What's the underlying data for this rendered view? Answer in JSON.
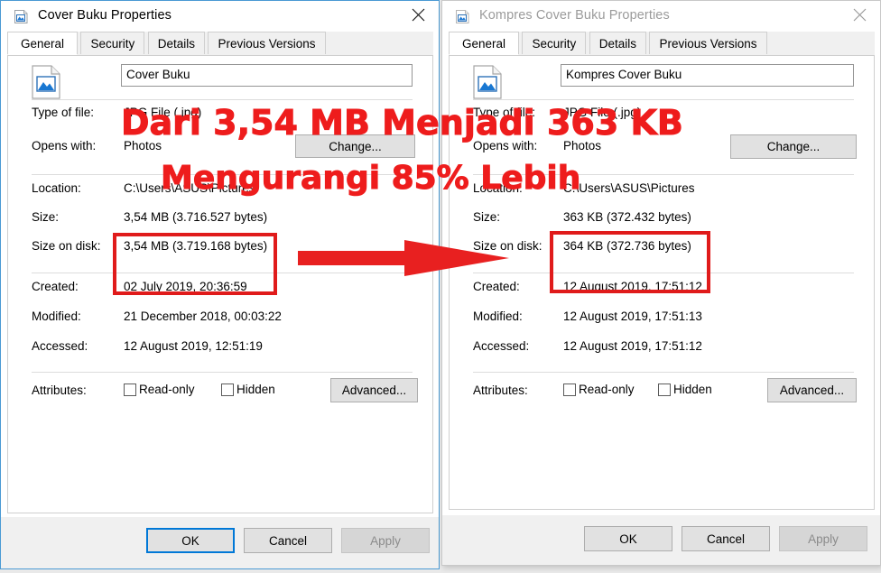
{
  "windows": [
    {
      "id": "left",
      "title": "Cover Buku Properties",
      "title_icon": "image-file-icon",
      "close_icon": "close-icon",
      "tabs": [
        {
          "label": "General",
          "active": true
        },
        {
          "label": "Security",
          "active": false
        },
        {
          "label": "Details",
          "active": false
        },
        {
          "label": "Previous Versions",
          "active": false
        }
      ],
      "file_name": "Cover Buku",
      "fields": [
        {
          "label": "Type of file:",
          "value": "JPG File (.jpg)"
        },
        {
          "label": "Opens with:",
          "value": "Photos"
        },
        {
          "label": "Location:",
          "value": "C:\\Users\\ASUS\\Pictures"
        },
        {
          "label": "Size:",
          "value": "3,54 MB (3.716.527 bytes)"
        },
        {
          "label": "Size on disk:",
          "value": "3,54 MB (3.719.168 bytes)"
        },
        {
          "label": "Created:",
          "value": "02 July 2019, 20:36:59"
        },
        {
          "label": "Modified:",
          "value": "21 December 2018, 00:03:22"
        },
        {
          "label": "Accessed:",
          "value": "12 August 2019, 12:51:19"
        }
      ],
      "change_button": "Change...",
      "attributes_label": "Attributes:",
      "readonly_label": "Read-only",
      "hidden_label": "Hidden",
      "advanced_button": "Advanced...",
      "footer": {
        "ok": "OK",
        "cancel": "Cancel",
        "apply": "Apply"
      }
    },
    {
      "id": "right",
      "title": "Kompres Cover Buku Properties",
      "title_icon": "image-file-icon",
      "close_icon": "close-icon",
      "tabs": [
        {
          "label": "General",
          "active": true
        },
        {
          "label": "Security",
          "active": false
        },
        {
          "label": "Details",
          "active": false
        },
        {
          "label": "Previous Versions",
          "active": false
        }
      ],
      "file_name": "Kompres Cover Buku",
      "fields": [
        {
          "label": "Type of file:",
          "value": "JPG File (.jpg)"
        },
        {
          "label": "Opens with:",
          "value": "Photos"
        },
        {
          "label": "Location:",
          "value": "C:\\Users\\ASUS\\Pictures"
        },
        {
          "label": "Size:",
          "value": "363 KB (372.432 bytes)"
        },
        {
          "label": "Size on disk:",
          "value": "364 KB (372.736 bytes)"
        },
        {
          "label": "Created:",
          "value": "12 August 2019, 17:51:12"
        },
        {
          "label": "Modified:",
          "value": "12 August 2019, 17:51:13"
        },
        {
          "label": "Accessed:",
          "value": "12 August 2019, 17:51:12"
        }
      ],
      "change_button": "Change...",
      "attributes_label": "Attributes:",
      "readonly_label": "Read-only",
      "hidden_label": "Hidden",
      "advanced_button": "Advanced...",
      "footer": {
        "ok": "OK",
        "cancel": "Cancel",
        "apply": "Apply"
      }
    }
  ],
  "annotations": {
    "headline": "Dari 3,54 MB Menjadi 363 KB",
    "subline": "Mengurangi 85% Lebih",
    "color": "#ee1c1c",
    "box_color": "#e01b1b",
    "arrow_icon": "red-right-arrow"
  }
}
